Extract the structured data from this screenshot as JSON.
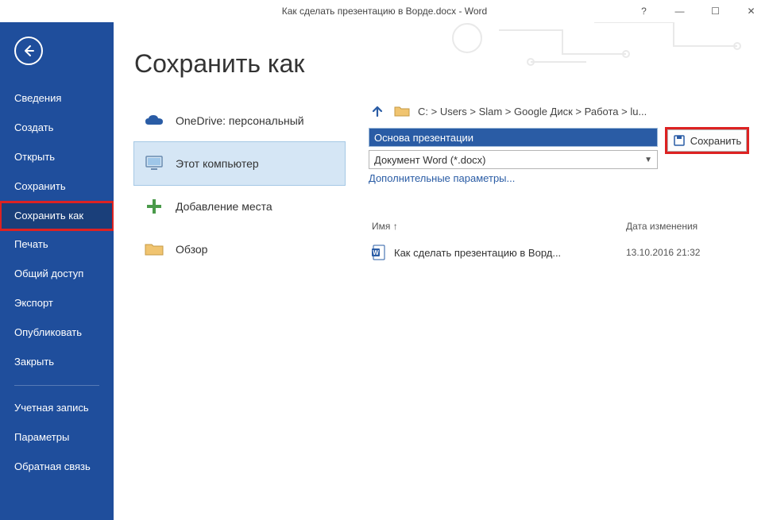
{
  "window": {
    "title": "Как сделать презентацию в Ворде.docx - Word",
    "help_glyph": "?",
    "min_glyph": "—",
    "max_glyph": "☐",
    "close_glyph": "✕"
  },
  "sidebar": {
    "items": [
      {
        "label": "Сведения",
        "active": false
      },
      {
        "label": "Создать",
        "active": false
      },
      {
        "label": "Открыть",
        "active": false
      },
      {
        "label": "Сохранить",
        "active": false
      },
      {
        "label": "Сохранить как",
        "active": true,
        "highlight": true
      },
      {
        "label": "Печать",
        "active": false
      },
      {
        "label": "Общий доступ",
        "active": false
      },
      {
        "label": "Экспорт",
        "active": false
      },
      {
        "label": "Опубликовать",
        "active": false
      },
      {
        "label": "Закрыть",
        "active": false
      }
    ],
    "footer": [
      {
        "label": "Учетная запись"
      },
      {
        "label": "Параметры"
      },
      {
        "label": "Обратная связь"
      }
    ]
  },
  "page": {
    "title": "Сохранить как"
  },
  "locations": [
    {
      "key": "onedrive",
      "label": "OneDrive: персональный",
      "selected": false
    },
    {
      "key": "thispc",
      "label": "Этот компьютер",
      "selected": true
    },
    {
      "key": "addplace",
      "label": "Добавление места",
      "selected": false
    },
    {
      "key": "browse",
      "label": "Обзор",
      "selected": false
    }
  ],
  "right": {
    "breadcrumb": "C: > Users > Slam > Google Диск > Работа > lu...",
    "filename": "Основа презентации",
    "filetype": "Документ Word (*.docx)",
    "extra_link": "Дополнительные параметры...",
    "save_label": "Сохранить",
    "headers": {
      "name": "Имя ↑",
      "date": "Дата изменения"
    },
    "files": [
      {
        "name": "Как сделать презентацию в Ворд...",
        "date": "13.10.2016 21:32"
      }
    ]
  },
  "colors": {
    "brand": "#1f4e9c",
    "accent_link": "#2a5ca5",
    "highlight": "#d22",
    "selection_bg": "#d5e6f5"
  }
}
